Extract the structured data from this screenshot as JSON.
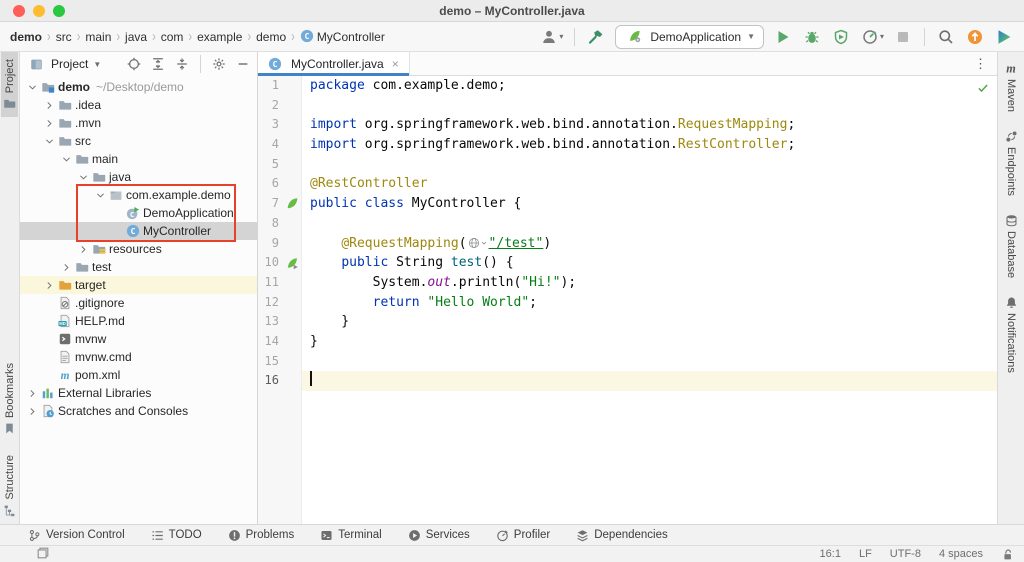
{
  "window": {
    "title": "demo – MyController.java"
  },
  "traffic_lights": {
    "close": "#FF5F57",
    "minimize": "#FEBC2E",
    "zoom": "#28C840"
  },
  "colors": {
    "accent_blue": "#4083C9",
    "selection_gray": "#D4D4D4",
    "current_line": "#FBF7E3",
    "annotation_red": "#E8402A",
    "spring_green": "#68BC45",
    "run_green": "#59A869"
  },
  "navbar": {
    "breadcrumbs": [
      {
        "label": "demo",
        "bold": true
      },
      {
        "label": "src"
      },
      {
        "label": "main"
      },
      {
        "label": "java"
      },
      {
        "label": "com"
      },
      {
        "label": "example"
      },
      {
        "label": "demo"
      },
      {
        "label": "MyController",
        "icon": "class-icon"
      }
    ],
    "run_config": {
      "label": "DemoApplication",
      "icon": "spring-boot-icon"
    },
    "left_tools": [
      {
        "name": "profile-menu",
        "icon": "user-icon",
        "dropdown": true
      },
      {
        "name": "divider"
      },
      {
        "name": "build-project-button",
        "icon": "hammer-icon"
      }
    ],
    "right_tools": [
      {
        "name": "run-button",
        "icon": "run-icon"
      },
      {
        "name": "debug-button",
        "icon": "debug-icon"
      },
      {
        "name": "coverage-button",
        "icon": "coverage-icon"
      },
      {
        "name": "profiler-button",
        "icon": "profiler-run-icon",
        "dropdown": true
      },
      {
        "name": "stop-button",
        "icon": "stop-icon"
      },
      {
        "name": "divider"
      },
      {
        "name": "search-everywhere-button",
        "icon": "search-icon"
      },
      {
        "name": "update-button",
        "icon": "update-icon"
      },
      {
        "name": "ide-play-button",
        "icon": "gradient-play-icon"
      }
    ]
  },
  "left_stripe": [
    {
      "label": "Project",
      "icon": "folder-tool-icon",
      "active": true
    },
    {
      "label": "Bookmarks",
      "icon": "bookmark-icon"
    },
    {
      "label": "Structure",
      "icon": "structure-icon"
    }
  ],
  "project_panel": {
    "header": {
      "title": "Project",
      "tools": [
        "locate-icon",
        "expand-all-icon",
        "collapse-all-icon",
        "divider",
        "gear-icon",
        "hide-icon"
      ]
    },
    "tree": [
      {
        "label": "demo",
        "secondary": "~/Desktop/demo",
        "level": 0,
        "chevron": "down",
        "icon": "folder-project",
        "bold": true
      },
      {
        "label": ".idea",
        "level": 1,
        "chevron": "right",
        "icon": "folder"
      },
      {
        "label": ".mvn",
        "level": 1,
        "chevron": "right",
        "icon": "folder"
      },
      {
        "label": "src",
        "level": 1,
        "chevron": "down",
        "icon": "folder"
      },
      {
        "label": "main",
        "level": 2,
        "chevron": "down",
        "icon": "folder"
      },
      {
        "label": "java",
        "level": 3,
        "chevron": "down",
        "icon": "folder"
      },
      {
        "label": "com.example.demo",
        "level": 4,
        "chevron": "down",
        "icon": "package"
      },
      {
        "label": "DemoApplication",
        "level": 5,
        "chevron": "none",
        "icon": "class-boot"
      },
      {
        "label": "MyController",
        "level": 5,
        "chevron": "none",
        "icon": "class",
        "selected": true
      },
      {
        "label": "resources",
        "level": 3,
        "chevron": "right",
        "icon": "folder-resources"
      },
      {
        "label": "test",
        "level": 2,
        "chevron": "right",
        "icon": "folder"
      },
      {
        "label": "target",
        "level": 1,
        "chevron": "right",
        "icon": "folder-excluded",
        "highlight": true
      },
      {
        "label": ".gitignore",
        "level": 1,
        "chevron": "none",
        "icon": "file-ignore"
      },
      {
        "label": "HELP.md",
        "level": 1,
        "chevron": "none",
        "icon": "file-md"
      },
      {
        "label": "mvnw",
        "level": 1,
        "chevron": "none",
        "icon": "file-sh"
      },
      {
        "label": "mvnw.cmd",
        "level": 1,
        "chevron": "none",
        "icon": "file-text"
      },
      {
        "label": "pom.xml",
        "level": 1,
        "chevron": "none",
        "icon": "maven"
      },
      {
        "label": "External Libraries",
        "level": 0,
        "chevron": "right",
        "icon": "ext-lib"
      },
      {
        "label": "Scratches and Consoles",
        "level": 0,
        "chevron": "right",
        "icon": "scratches"
      }
    ],
    "annotation_red_box_rows": [
      "com.example.demo",
      "DemoApplication",
      "MyController"
    ]
  },
  "editor": {
    "tab": {
      "label": "MyController.java",
      "icon": "class-icon",
      "close": "×"
    },
    "inspection_status": "no-problems-check",
    "caret_position": {
      "line": 16,
      "column": 1
    },
    "lines": [
      {
        "n": 1,
        "tokens": [
          [
            "k",
            "package"
          ],
          [
            "p",
            " com.example.demo;"
          ]
        ]
      },
      {
        "n": 2,
        "tokens": []
      },
      {
        "n": 3,
        "tokens": [
          [
            "k",
            "import"
          ],
          [
            "p",
            " org.springframework.web.bind.annotation."
          ],
          [
            "a",
            "RequestMapping"
          ],
          [
            "p",
            ";"
          ]
        ]
      },
      {
        "n": 4,
        "tokens": [
          [
            "k",
            "import"
          ],
          [
            "p",
            " org.springframework.web.bind.annotation."
          ],
          [
            "a",
            "RestController"
          ],
          [
            "p",
            ";"
          ]
        ]
      },
      {
        "n": 5,
        "tokens": []
      },
      {
        "n": 6,
        "tokens": [
          [
            "a",
            "@RestController"
          ]
        ]
      },
      {
        "n": 7,
        "gicon": "spring-leaf",
        "tokens": [
          [
            "k",
            "public"
          ],
          [
            "p",
            " "
          ],
          [
            "k",
            "class"
          ],
          [
            "p",
            " MyController {"
          ]
        ]
      },
      {
        "n": 8,
        "tokens": []
      },
      {
        "n": 9,
        "tokens": [
          [
            "p",
            "    "
          ],
          [
            "a",
            "@RequestMapping"
          ],
          [
            "p",
            "("
          ],
          [
            "icon",
            "globe-inlay"
          ],
          [
            "sl",
            "\"/test\""
          ],
          [
            "p",
            ")"
          ]
        ]
      },
      {
        "n": 10,
        "gicon": "spring-leaf-run",
        "tokens": [
          [
            "p",
            "    "
          ],
          [
            "k",
            "public"
          ],
          [
            "p",
            " String "
          ],
          [
            "m",
            "test"
          ],
          [
            "p",
            "() {"
          ]
        ]
      },
      {
        "n": 11,
        "tokens": [
          [
            "p",
            "        System."
          ],
          [
            "f",
            "out"
          ],
          [
            "p",
            ".println("
          ],
          [
            "s",
            "\"Hi!\""
          ],
          [
            "p",
            ");"
          ]
        ]
      },
      {
        "n": 12,
        "tokens": [
          [
            "p",
            "        "
          ],
          [
            "k",
            "return"
          ],
          [
            "p",
            " "
          ],
          [
            "s",
            "\"Hello World\""
          ],
          [
            "p",
            ";"
          ]
        ]
      },
      {
        "n": 13,
        "tokens": [
          [
            "p",
            "    }"
          ]
        ]
      },
      {
        "n": 14,
        "tokens": [
          [
            "p",
            "}"
          ]
        ]
      },
      {
        "n": 15,
        "tokens": []
      },
      {
        "n": 16,
        "tokens": [],
        "current": true,
        "caret": true
      }
    ]
  },
  "right_stripe": [
    {
      "label": "Maven",
      "icon": "maven-m-icon"
    },
    {
      "label": "Endpoints",
      "icon": "endpoints-icon"
    },
    {
      "label": "Database",
      "icon": "database-icon"
    },
    {
      "label": "Notifications",
      "icon": "bell-icon"
    }
  ],
  "bottom_bar": [
    {
      "label": "Version Control",
      "icon": "branch-icon"
    },
    {
      "label": "TODO",
      "icon": "todo-icon"
    },
    {
      "label": "Problems",
      "icon": "problems-icon"
    },
    {
      "label": "Terminal",
      "icon": "terminal-icon"
    },
    {
      "label": "Services",
      "icon": "services-icon"
    },
    {
      "label": "Profiler",
      "icon": "profiler-icon"
    },
    {
      "label": "Dependencies",
      "icon": "dependencies-icon"
    }
  ],
  "status_bar": {
    "left_icon": "window-layout-icon",
    "items": [
      {
        "name": "caret-position",
        "label": "16:1"
      },
      {
        "name": "line-separator",
        "label": "LF"
      },
      {
        "name": "encoding",
        "label": "UTF-8"
      },
      {
        "name": "indent",
        "label": "4 spaces"
      },
      {
        "name": "readonly-toggle",
        "icon": "unlock-icon"
      }
    ]
  }
}
